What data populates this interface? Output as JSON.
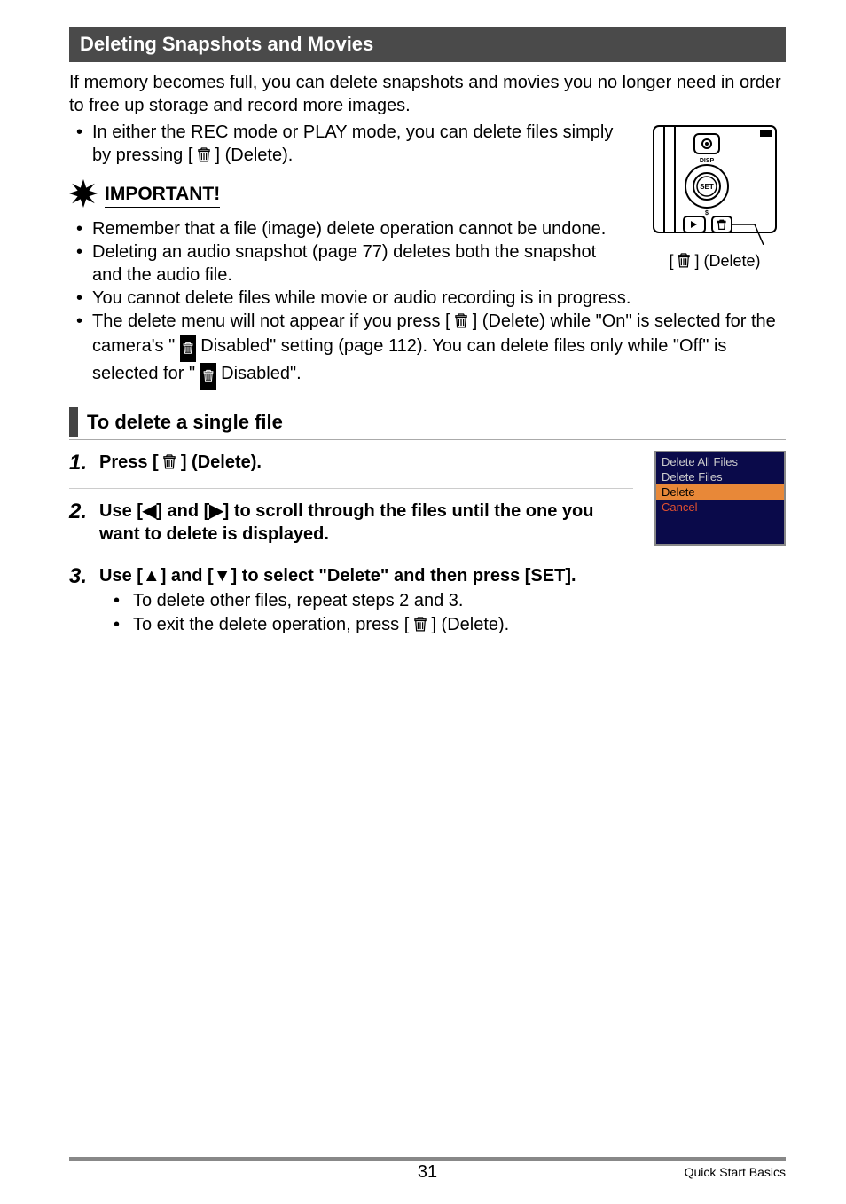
{
  "header": {
    "title": "Deleting Snapshots and Movies"
  },
  "intro": "If memory becomes full, you can delete snapshots and movies you no longer need in order to free up storage and record more images.",
  "intro_bullet_a": "In either the REC mode or PLAY mode, you can delete files simply by pressing [",
  "intro_bullet_b": "] (Delete).",
  "diagram_caption_a": "[",
  "diagram_caption_b": "] (Delete)",
  "important_label": "IMPORTANT!",
  "important_items": {
    "i1": "Remember that a file (image) delete operation cannot be undone.",
    "i2": "Deleting an audio snapshot (page 77) deletes both the snapshot and the audio file.",
    "i3": "You cannot delete files while movie or audio recording is in progress.",
    "i4a": "The delete menu will not appear if you press [",
    "i4b": "] (Delete) while \"On\" is selected for the camera's \"",
    "i4c": " Disabled\" setting (page 112). You can delete files only while \"Off\" is selected for \"",
    "i4d": " Disabled\"."
  },
  "subheader": "To delete a single file",
  "steps": {
    "s1_num": "1.",
    "s1a": "Press [",
    "s1b": "] (Delete).",
    "s2_num": "2.",
    "s2": "Use [◀] and [▶] to scroll through the files until the one you want to delete is displayed.",
    "s3_num": "3.",
    "s3": "Use [▲] and [▼] to select \"Delete\" and then press [SET].",
    "s3_sub1": "To delete other files, repeat steps 2 and 3.",
    "s3_sub2a": "To exit the delete operation, press [",
    "s3_sub2b": "] (Delete)."
  },
  "menu": {
    "m1": "Delete All Files",
    "m2": "Delete Files",
    "m3": "Delete",
    "m4": "Cancel"
  },
  "footer": {
    "page": "31",
    "crumb": "Quick Start Basics"
  }
}
